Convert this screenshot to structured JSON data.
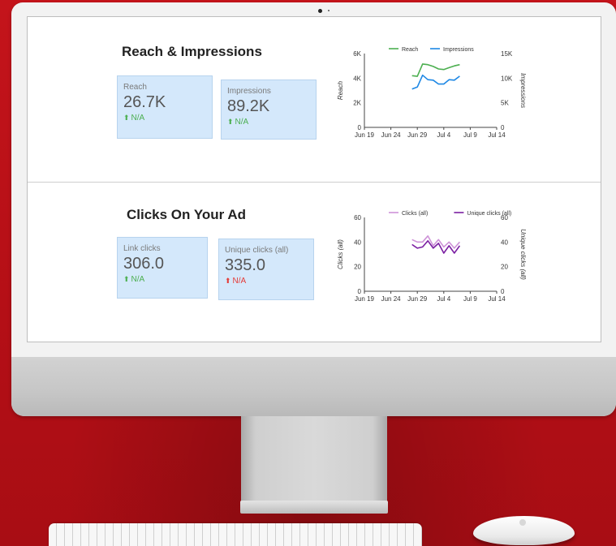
{
  "reach_section": {
    "title": "Reach & Impressions",
    "cards": [
      {
        "label": "Reach",
        "value": "26.7K",
        "change": "N/A",
        "direction": "up"
      },
      {
        "label": "Impressions",
        "value": "89.2K",
        "change": "N/A",
        "direction": "up"
      }
    ]
  },
  "clicks_section": {
    "title": "Clicks On Your Ad",
    "cards": [
      {
        "label": "Link clicks",
        "value": "306.0",
        "change": "N/A",
        "direction": "up"
      },
      {
        "label": "Unique clicks (all)",
        "value": "335.0",
        "change": "N/A",
        "direction": "down"
      }
    ]
  },
  "colors": {
    "reach": "#4caf50",
    "impressions": "#1e88e5",
    "clicks": "#ce93d8",
    "unique_clicks": "#7b1fa2",
    "up": "#4caf50",
    "down": "#e53935",
    "card_bg": "#d4e8fb"
  },
  "chart_data": [
    {
      "type": "line",
      "x_tick_labels": [
        "Jun 19",
        "Jun 24",
        "Jun 29",
        "Jul 4",
        "Jul 9",
        "Jul 14"
      ],
      "xlabel": "",
      "ylabel": "Reach",
      "y2label": "Impressions",
      "ylim": [
        0,
        6000
      ],
      "y_tick_labels": [
        "0",
        "2K",
        "4K",
        "6K"
      ],
      "y2lim": [
        0,
        15000
      ],
      "y2_tick_labels": [
        "0",
        "5K",
        "10K",
        "15K"
      ],
      "grid": false,
      "legend": "top",
      "series": [
        {
          "name": "Reach",
          "axis": "left",
          "x": [
            "Jun 28",
            "Jun 29",
            "Jun 30",
            "Jul 1",
            "Jul 2",
            "Jul 3",
            "Jul 4",
            "Jul 5",
            "Jul 6",
            "Jul 7"
          ],
          "y": [
            4200,
            4150,
            5150,
            5100,
            4950,
            4750,
            4700,
            4850,
            5000,
            5100
          ]
        },
        {
          "name": "Impressions",
          "axis": "right",
          "x": [
            "Jun 28",
            "Jun 29",
            "Jun 30",
            "Jul 1",
            "Jul 2",
            "Jul 3",
            "Jul 4",
            "Jul 5",
            "Jul 6",
            "Jul 7"
          ],
          "y": [
            7800,
            8200,
            10600,
            9700,
            9600,
            8800,
            8800,
            9700,
            9600,
            10400
          ]
        }
      ]
    },
    {
      "type": "line",
      "x_tick_labels": [
        "Jun 19",
        "Jun 24",
        "Jun 29",
        "Jul 4",
        "Jul 9",
        "Jul 14"
      ],
      "xlabel": "",
      "ylabel": "Clicks (all)",
      "y2label": "Unique clicks (all)",
      "ylim": [
        0,
        60
      ],
      "y_tick_labels": [
        "0",
        "20",
        "40",
        "60"
      ],
      "y2lim": [
        0,
        60
      ],
      "y2_tick_labels": [
        "0",
        "20",
        "40",
        "60"
      ],
      "grid": false,
      "legend": "top",
      "series": [
        {
          "name": "Clicks (all)",
          "axis": "left",
          "x": [
            "Jun 28",
            "Jun 29",
            "Jun 30",
            "Jul 1",
            "Jul 2",
            "Jul 3",
            "Jul 4",
            "Jul 5",
            "Jul 6",
            "Jul 7"
          ],
          "y": [
            42,
            40,
            40,
            45,
            37,
            42,
            36,
            40,
            35,
            40
          ]
        },
        {
          "name": "Unique clicks (all)",
          "axis": "right",
          "x": [
            "Jun 28",
            "Jun 29",
            "Jun 30",
            "Jul 1",
            "Jul 2",
            "Jul 3",
            "Jul 4",
            "Jul 5",
            "Jul 6",
            "Jul 7"
          ],
          "y": [
            38,
            35,
            36,
            41,
            35,
            39,
            31,
            37,
            31,
            37
          ]
        }
      ]
    }
  ]
}
